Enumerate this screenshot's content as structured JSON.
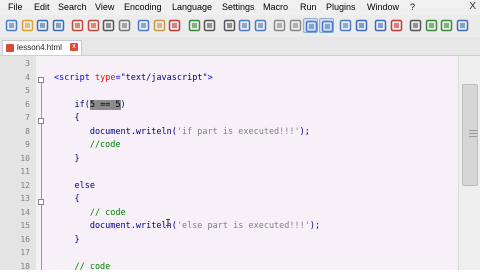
{
  "menu": {
    "items": [
      "File",
      "Edit",
      "Search",
      "View",
      "Encoding",
      "Language",
      "Settings",
      "Macro",
      "Run",
      "Plugins",
      "Window",
      "?"
    ],
    "close": "X"
  },
  "toolbar": {
    "icons": [
      "new-file-icon",
      "open-file-icon",
      "save-icon",
      "save-all-icon",
      "close-icon",
      "close-all-icon",
      "print-icon",
      "cut-icon",
      "copy-icon",
      "paste-icon",
      "undo-icon",
      "redo-icon",
      "find-icon",
      "replace-icon",
      "zoom-in-icon",
      "zoom-out-icon",
      "sync-v-icon",
      "sync-h-icon",
      "word-wrap-icon",
      "show-all-chars-icon",
      "indent-guide-icon",
      "doc-map-icon",
      "function-list-icon",
      "record-macro-icon",
      "stop-macro-icon",
      "play-macro-icon",
      "run-macro-icon",
      "save-macro-icon"
    ]
  },
  "tab": {
    "label": "lesson4.html",
    "close": "x"
  },
  "editor": {
    "lines": [
      {
        "n": "3",
        "segments": []
      },
      {
        "n": "4",
        "segments": [
          {
            "t": "<",
            "c": "tag"
          },
          {
            "t": "script",
            "c": "tag"
          },
          {
            "t": " type",
            "c": "attr"
          },
          {
            "t": "=",
            "c": "tag"
          },
          {
            "t": "\"text/",
            "c": "kw"
          },
          {
            "t": "javascript",
            "c": "kw"
          },
          {
            "t": "\"",
            "c": "kw"
          },
          {
            "t": ">",
            "c": "tag"
          }
        ]
      },
      {
        "n": "5",
        "segments": []
      },
      {
        "n": "6",
        "segments": [
          {
            "t": "    if(",
            "c": "kw"
          },
          {
            "t": "5 == 5",
            "c": "sel"
          },
          {
            "t": ")",
            "c": "kw"
          }
        ]
      },
      {
        "n": "7",
        "segments": [
          {
            "t": "    {",
            "c": "kw"
          }
        ]
      },
      {
        "n": "8",
        "segments": [
          {
            "t": "       document.writeln(",
            "c": "kw"
          },
          {
            "t": "'if part is executed!!!'",
            "c": "str"
          },
          {
            "t": ");",
            "c": "kw"
          }
        ]
      },
      {
        "n": "9",
        "segments": [
          {
            "t": "       //code",
            "c": "cmt"
          }
        ]
      },
      {
        "n": "10",
        "segments": [
          {
            "t": "    }",
            "c": "kw"
          }
        ]
      },
      {
        "n": "11",
        "segments": []
      },
      {
        "n": "12",
        "segments": [
          {
            "t": "    else",
            "c": "kw"
          }
        ]
      },
      {
        "n": "13",
        "segments": [
          {
            "t": "    {",
            "c": "kw"
          }
        ]
      },
      {
        "n": "14",
        "segments": [
          {
            "t": "       // code",
            "c": "cmt"
          }
        ]
      },
      {
        "n": "15",
        "segments": [
          {
            "t": "       document.writeln(",
            "c": "kw"
          },
          {
            "t": "'else part is executed!!!'",
            "c": "str"
          },
          {
            "t": ");",
            "c": "kw"
          }
        ]
      },
      {
        "n": "16",
        "segments": [
          {
            "t": "    }",
            "c": "kw"
          }
        ]
      },
      {
        "n": "17",
        "segments": []
      },
      {
        "n": "18",
        "segments": [
          {
            "t": "    // code",
            "c": "cmt"
          }
        ]
      }
    ]
  },
  "colors": {
    "code_bg": "#f7f0f8",
    "gutter_bg": "#e4e4e4",
    "keyword": "#000080",
    "string": "#808080",
    "comment": "#008000",
    "tag": "#0000ff",
    "attribute": "#ff0000",
    "selection": "#8c8c8c"
  }
}
